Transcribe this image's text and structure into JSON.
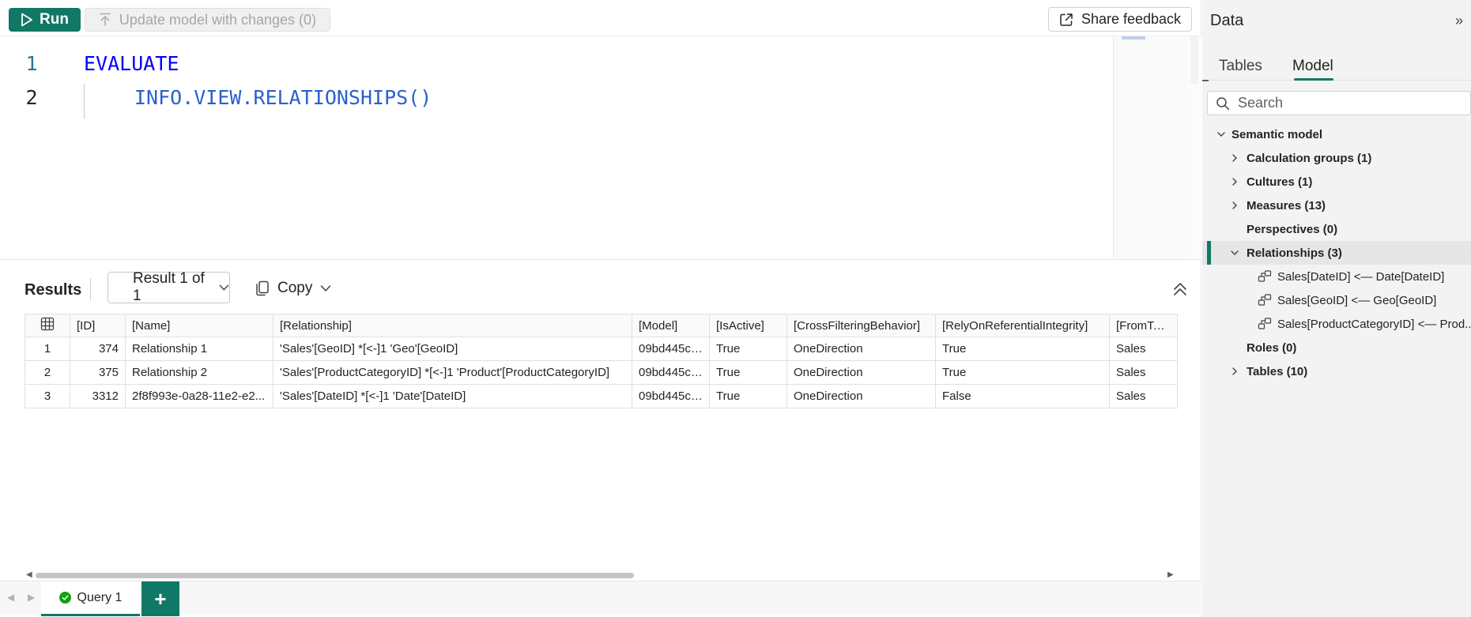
{
  "toolbar": {
    "run_label": "Run",
    "update_label": "Update model with changes (0)",
    "feedback_label": "Share feedback"
  },
  "editor": {
    "lines": [
      {
        "number": "1",
        "code": "EVALUATE"
      },
      {
        "number": "2",
        "code": "INFO.VIEW.RELATIONSHIPS()"
      }
    ]
  },
  "results": {
    "title": "Results",
    "selector": "Result 1 of 1",
    "copy_label": "Copy",
    "columns": [
      "[ID]",
      "[Name]",
      "[Relationship]",
      "[Model]",
      "[IsActive]",
      "[CrossFilteringBehavior]",
      "[RelyOnReferentialIntegrity]",
      "[FromTable]"
    ],
    "rows": [
      {
        "n": "1",
        "id": "374",
        "name": "Relationship 1",
        "relationship": "'Sales'[GeoID] *[<-]1 'Geo'[GeoID]",
        "model": "09bd445c-...",
        "active": "True",
        "cross": "OneDirection",
        "rely": "True",
        "from": "Sales"
      },
      {
        "n": "2",
        "id": "375",
        "name": "Relationship 2",
        "relationship": "'Sales'[ProductCategoryID] *[<-]1 'Product'[ProductCategoryID]",
        "model": "09bd445c-...",
        "active": "True",
        "cross": "OneDirection",
        "rely": "True",
        "from": "Sales"
      },
      {
        "n": "3",
        "id": "3312",
        "name": "2f8f993e-0a28-11e2-e2...",
        "relationship": "'Sales'[DateID] *[<-]1 'Date'[DateID]",
        "model": "09bd445c-...",
        "active": "True",
        "cross": "OneDirection",
        "rely": "False",
        "from": "Sales"
      }
    ]
  },
  "query_tabs": {
    "active_label": "Query 1",
    "add_label": "+"
  },
  "data_pane": {
    "title": "Data",
    "tabs": [
      "Tables",
      "Model"
    ],
    "active_tab": "Model",
    "search_placeholder": "Search",
    "tree": {
      "root": "Semantic model",
      "calc_groups": "Calculation groups (1)",
      "cultures": "Cultures (1)",
      "measures": "Measures (13)",
      "perspectives": "Perspectives (0)",
      "relationships": "Relationships (3)",
      "rel_items": [
        "Sales[DateID] <— Date[DateID]",
        "Sales[GeoID] <— Geo[GeoID]",
        "Sales[ProductCategoryID] <— Prod..."
      ],
      "roles": "Roles (0)",
      "tables": "Tables (10)"
    }
  },
  "colors": {
    "accent": "#117865",
    "keyword": "#0000ff",
    "function": "#2a61c9",
    "success": "#13a10e"
  }
}
